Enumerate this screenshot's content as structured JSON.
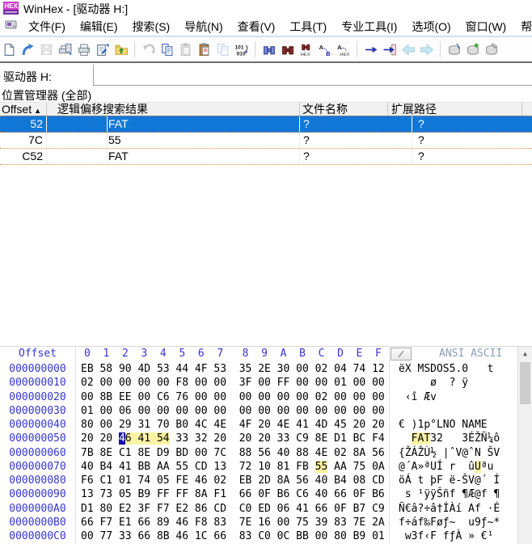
{
  "window": {
    "title": "WinHex - [驱动器 H:]"
  },
  "menu": {
    "items": [
      "文件(F)",
      "编辑(E)",
      "搜索(S)",
      "导航(N)",
      "查看(V)",
      "工具(T)",
      "专业工具(I)",
      "选项(O)",
      "窗口(W)",
      "帮助"
    ]
  },
  "toolbar": {
    "items": [
      {
        "icon": "new-file-icon"
      },
      {
        "icon": "open-icon"
      },
      {
        "icon": "save-icon",
        "disabled": true
      },
      {
        "icon": "print-preview-icon"
      },
      {
        "icon": "print-icon"
      },
      {
        "icon": "properties-icon"
      },
      {
        "icon": "folder-up-icon"
      },
      {
        "separator": true
      },
      {
        "icon": "undo-icon",
        "disabled": true
      },
      {
        "icon": "copy-icon"
      },
      {
        "icon": "paste-icon",
        "disabled": true
      },
      {
        "icon": "clipboard-paste-icon"
      },
      {
        "icon": "copy-block-icon",
        "disabled": true
      },
      {
        "icon": "binary-convert-icon"
      },
      {
        "separator": true
      },
      {
        "icon": "search-binoculars-icon"
      },
      {
        "icon": "search-again-binoculars-icon"
      },
      {
        "icon": "hex-search-icon"
      },
      {
        "icon": "replace-text-icon"
      },
      {
        "icon": "hex-replace-icon"
      },
      {
        "separator": true
      },
      {
        "icon": "goto-offset-icon"
      },
      {
        "icon": "goto-block-icon"
      },
      {
        "icon": "back-icon",
        "disabled": true
      },
      {
        "icon": "forward-icon",
        "disabled": true
      },
      {
        "separator": true
      },
      {
        "icon": "disk-refresh-icon"
      },
      {
        "icon": "disk-add-icon"
      },
      {
        "icon": "disk-tools-icon"
      }
    ]
  },
  "tab": {
    "label": "驱动器 H:"
  },
  "position_manager": {
    "title": "位置管理器 (全部)",
    "sort_indicator": "▲",
    "columns": [
      "Offset",
      "逻辑偏移搜索结果",
      "文件名称",
      "扩展路径"
    ],
    "rows": [
      {
        "offset": "52",
        "result": "FAT",
        "file": "?",
        "path": "?",
        "selected": true
      },
      {
        "offset": "7C",
        "result": "55",
        "file": "?",
        "path": "?",
        "selected": false
      },
      {
        "offset": "C52",
        "result": "FAT",
        "file": "?",
        "path": "?",
        "selected": false
      }
    ]
  },
  "hex_editor": {
    "offset_header": "Offset",
    "col_headers": [
      "0",
      "1",
      "2",
      "3",
      "4",
      "5",
      "6",
      "7",
      "8",
      "9",
      "A",
      "B",
      "C",
      "D",
      "E",
      "F"
    ],
    "layout_button": "╱",
    "ascii_header": "ANSI ASCII",
    "scroll_up_glyph": "▲",
    "rows": [
      {
        "offset": "000000000",
        "bytes": [
          "EB",
          "58",
          "90",
          "4D",
          "53",
          "44",
          "4F",
          "53",
          "35",
          "2E",
          "30",
          "00",
          "02",
          "04",
          "74",
          "12"
        ],
        "ascii": "ëX MSDOS5.0   t "
      },
      {
        "offset": "000000010",
        "bytes": [
          "02",
          "00",
          "00",
          "00",
          "00",
          "F8",
          "00",
          "00",
          "3F",
          "00",
          "FF",
          "00",
          "00",
          "01",
          "00",
          "00"
        ],
        "ascii": "     ø  ? ÿ     "
      },
      {
        "offset": "000000020",
        "bytes": [
          "00",
          "8B",
          "EE",
          "00",
          "C6",
          "76",
          "00",
          "00",
          "00",
          "00",
          "00",
          "00",
          "02",
          "00",
          "00",
          "00"
        ],
        "ascii": " ‹î Æv          "
      },
      {
        "offset": "000000030",
        "bytes": [
          "01",
          "00",
          "06",
          "00",
          "00",
          "00",
          "00",
          "00",
          "00",
          "00",
          "00",
          "00",
          "00",
          "00",
          "00",
          "00"
        ],
        "ascii": "                "
      },
      {
        "offset": "000000040",
        "bytes": [
          "80",
          "00",
          "29",
          "31",
          "70",
          "B0",
          "4C",
          "4E",
          "4F",
          "20",
          "4E",
          "41",
          "4D",
          "45",
          "20",
          "20"
        ],
        "ascii": "€ )1p°LNO NAME  "
      },
      {
        "offset": "000000050",
        "bytes": [
          "20",
          "20",
          "46",
          "41",
          "54",
          "33",
          "32",
          "20",
          "20",
          "20",
          "33",
          "C9",
          "8E",
          "D1",
          "BC",
          "F4"
        ],
        "ascii": "  FAT32   3ÉŽÑ¼ô"
      },
      {
        "offset": "000000060",
        "bytes": [
          "7B",
          "8E",
          "C1",
          "8E",
          "D9",
          "BD",
          "00",
          "7C",
          "88",
          "56",
          "40",
          "88",
          "4E",
          "02",
          "8A",
          "56"
        ],
        "ascii": "{ŽÁŽÙ½ |ˆV@ˆN ŠV"
      },
      {
        "offset": "000000070",
        "bytes": [
          "40",
          "B4",
          "41",
          "BB",
          "AA",
          "55",
          "CD",
          "13",
          "72",
          "10",
          "81",
          "FB",
          "55",
          "AA",
          "75",
          "0A"
        ],
        "ascii": "@´A»ªUÍ r  ûUªu "
      },
      {
        "offset": "000000080",
        "bytes": [
          "F6",
          "C1",
          "01",
          "74",
          "05",
          "FE",
          "46",
          "02",
          "EB",
          "2D",
          "8A",
          "56",
          "40",
          "B4",
          "08",
          "CD"
        ],
        "ascii": "öÁ t þF ë-ŠV@´ Í"
      },
      {
        "offset": "000000090",
        "bytes": [
          "13",
          "73",
          "05",
          "B9",
          "FF",
          "FF",
          "8A",
          "F1",
          "66",
          "0F",
          "B6",
          "C6",
          "40",
          "66",
          "0F",
          "B6"
        ],
        "ascii": " s ¹ÿÿŠñf ¶Æ@f ¶"
      },
      {
        "offset": "0000000A0",
        "bytes": [
          "D1",
          "80",
          "E2",
          "3F",
          "F7",
          "E2",
          "86",
          "CD",
          "C0",
          "ED",
          "06",
          "41",
          "66",
          "0F",
          "B7",
          "C9"
        ],
        "ascii": "Ñ€â?÷â†ÍÀí Af ·É"
      },
      {
        "offset": "0000000B0",
        "bytes": [
          "66",
          "F7",
          "E1",
          "66",
          "89",
          "46",
          "F8",
          "83",
          "7E",
          "16",
          "00",
          "75",
          "39",
          "83",
          "7E",
          "2A"
        ],
        "ascii": "f÷áf‰Føƒ~  u9ƒ~*"
      },
      {
        "offset": "0000000C0",
        "bytes": [
          "00",
          "77",
          "33",
          "66",
          "8B",
          "46",
          "1C",
          "66",
          "83",
          "C0",
          "0C",
          "BB",
          "00",
          "80",
          "B9",
          "01"
        ],
        "ascii": " w3f‹F fƒÀ » €¹ "
      }
    ],
    "cursor": {
      "row_index": 5,
      "byte_index": 2
    },
    "search_hits": [
      {
        "row_index": 5,
        "byte_indexes": [
          2,
          3,
          4
        ],
        "ascii_indexes": [
          2,
          3,
          4
        ]
      },
      {
        "row_index": 7,
        "byte_indexes": [
          12
        ],
        "ascii_indexes": [
          12
        ]
      }
    ]
  },
  "colors": {
    "selection_blue": "#1177d7",
    "hit_yellow": "#faf3a5",
    "cursor_navy": "#12129f",
    "hex_offset_blue": "#3535cf",
    "ascii_header_grey": "#8c9cb8",
    "dotted_grid_orange": "#e08a3c"
  }
}
